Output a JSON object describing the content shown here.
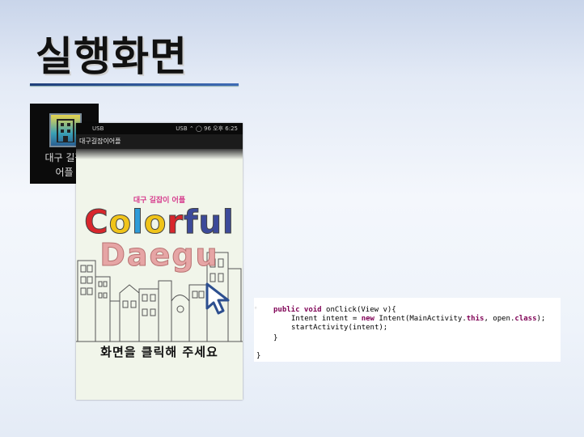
{
  "slide": {
    "title": "실행화면"
  },
  "launcher": {
    "icon": "app-building-icon",
    "label_line1": "대구 길잡",
    "label_line2": "어플"
  },
  "phone": {
    "status_left": "USB",
    "status_right": "USB ⌃ ◯ 96 오후 6:25",
    "app_title": "대구길잡이어플",
    "subtitle": "대구 길잡이 어플",
    "colorful_letters": [
      "C",
      "o",
      "l",
      "o",
      "r",
      "f",
      "u",
      "l"
    ],
    "colorful_colors": [
      "#d8262c",
      "#f0c419",
      "#2e9bd8",
      "#f0c419",
      "#d8262c",
      "#3c4a9a",
      "#3c4a9a",
      "#3c4a9a"
    ],
    "daegu": "Daegu",
    "tap_prompt": "화면을 클릭해 주세요"
  },
  "code": {
    "line1_kw": "public void",
    "line1_rest": " onClick(View v){",
    "line2_a": "Intent intent = ",
    "line2_kw": "new",
    "line2_b": " Intent(MainActivity.",
    "line2_kw2": "this",
    "line2_c": ", open.",
    "line2_kw3": "class",
    "line2_d": ");",
    "line3": "startActivity(intent);",
    "line4": "}",
    "line5": "}"
  }
}
